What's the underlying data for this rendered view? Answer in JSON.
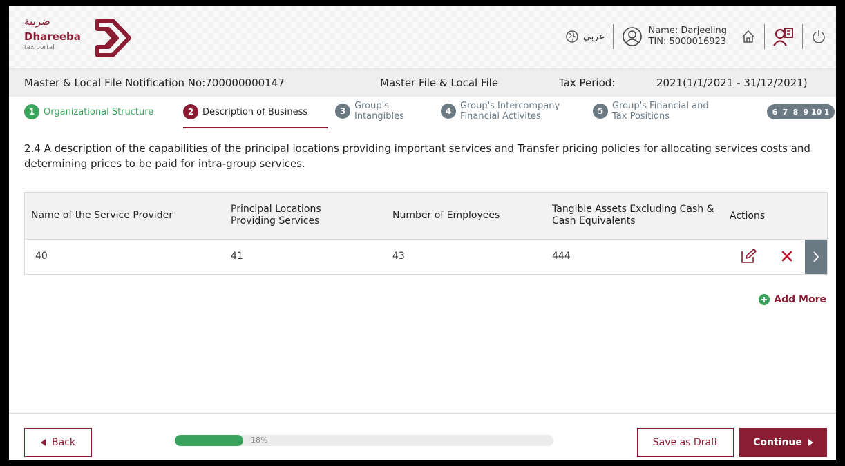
{
  "colors": {
    "brand": "#8a1c34",
    "success": "#3aa35b",
    "muted": "#6c7a84"
  },
  "header": {
    "logo_arabic": "ضريبة",
    "logo_name": "Dhareeba",
    "logo_sub": "tax portal",
    "language_label": "عربي",
    "user_name": "Name: Darjeeling",
    "user_tin": "TIN: 5000016923",
    "icons": [
      "globe-icon",
      "user-icon",
      "home-icon",
      "switch-account-icon",
      "power-icon"
    ]
  },
  "infobar": {
    "notification": "Master & Local File Notification No:700000000147",
    "file_type": "Master File & Local File",
    "tax_period_label": "Tax Period:",
    "tax_period_value": "2021(1/1/2021 - 31/12/2021)"
  },
  "stepper": {
    "steps": [
      {
        "num": "1",
        "label": "Organizational Structure",
        "state": "done"
      },
      {
        "num": "2",
        "label": "Description of Business",
        "state": "active"
      },
      {
        "num": "3",
        "label_line1": "Group's",
        "label_line2": "Intangibles",
        "state": "todo"
      },
      {
        "num": "4",
        "label_line1": "Group's Intercompany",
        "label_line2": "Financial Activites",
        "state": "todo"
      },
      {
        "num": "5",
        "label_line1": "Group's Financial and",
        "label_line2": "Tax Positions",
        "state": "todo"
      }
    ],
    "more": [
      "6",
      "7",
      "8",
      "9",
      "10",
      "1"
    ]
  },
  "section": {
    "description": "2.4 A description of the capabilities of the principal locations providing important services and Transfer pricing policies for allocating services costs and determining prices to be paid for intra-group services."
  },
  "table": {
    "headers": {
      "provider": "Name of the Service Provider",
      "locations_line1": "Principal Locations",
      "locations_line2": "Providing Services",
      "employees": "Number of Employees",
      "assets_line1": "Tangible Assets Excluding Cash &",
      "assets_line2": "Cash Equivalents",
      "actions": "Actions"
    },
    "rows": [
      {
        "provider": "40",
        "locations": "41",
        "employees": "43",
        "assets": "444"
      }
    ]
  },
  "add_more_label": "Add More",
  "footer": {
    "back_label": "Back",
    "progress_percent": 18,
    "progress_label": "18%",
    "save_draft_label": "Save as Draft",
    "continue_label": "Continue"
  }
}
